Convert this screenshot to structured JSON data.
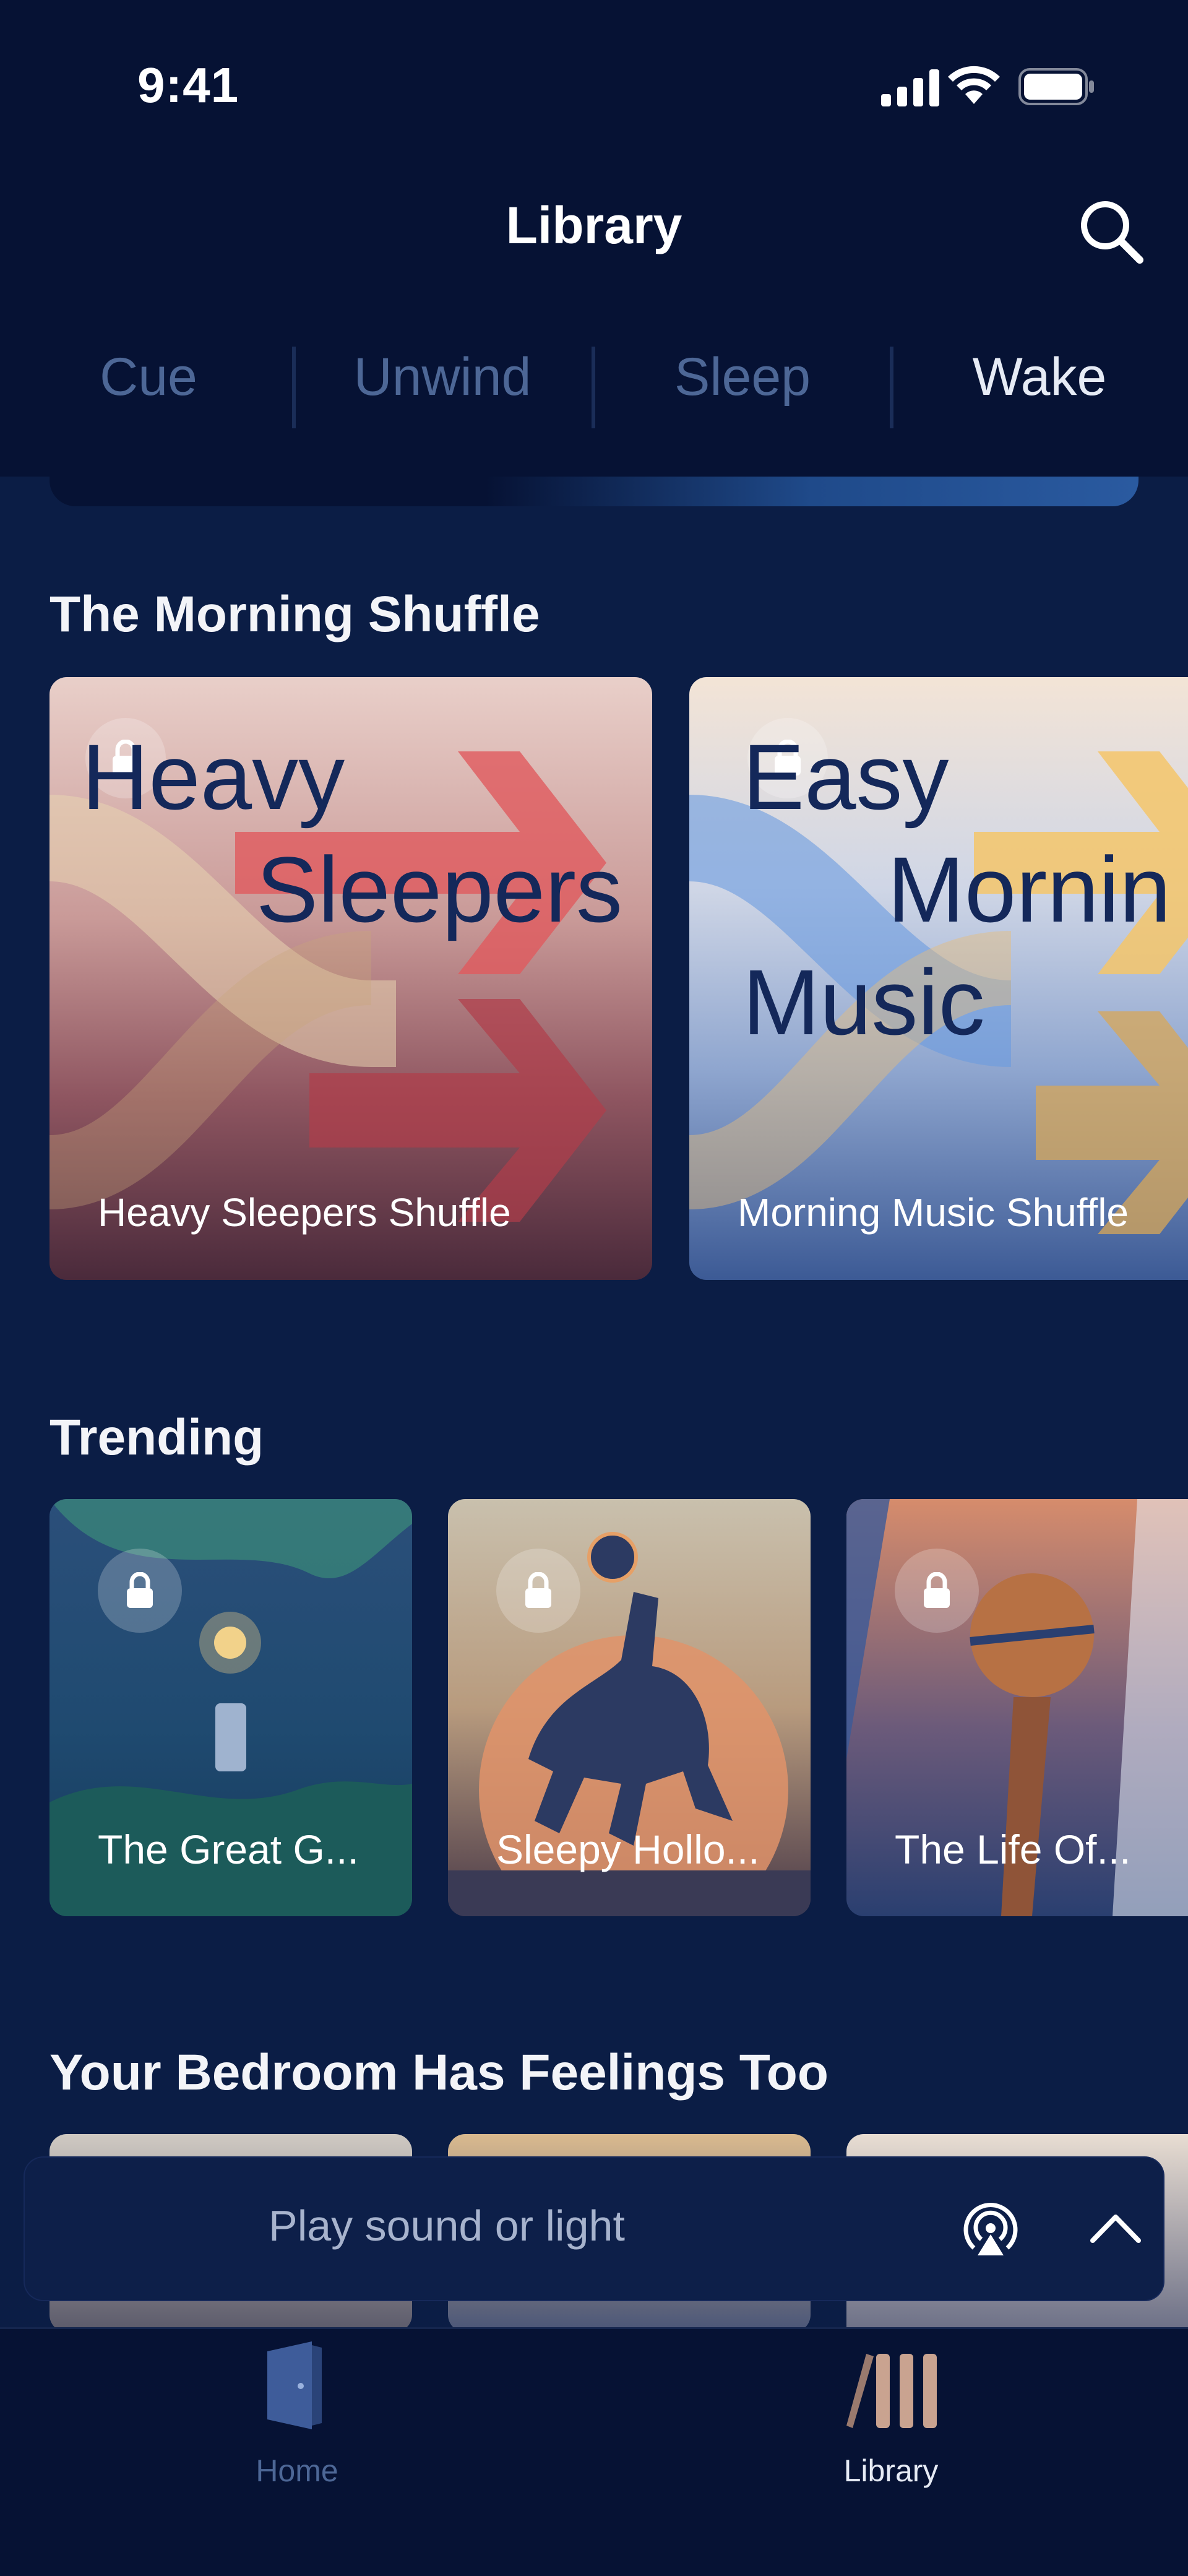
{
  "status_bar": {
    "time": "9:41"
  },
  "header": {
    "title": "Library"
  },
  "tabs": [
    {
      "label": "Cue",
      "active": false
    },
    {
      "label": "Unwind",
      "active": false
    },
    {
      "label": "Sleep",
      "active": false
    },
    {
      "label": "Wake",
      "active": true
    }
  ],
  "sections": {
    "morning_shuffle": {
      "title": "The Morning Shuffle",
      "cards": [
        {
          "art_line1": "Heavy",
          "art_line2": "Sleepers",
          "caption": "Heavy Sleepers Shuffle",
          "locked": true
        },
        {
          "art_line1": "Easy",
          "art_line2": "Mornin",
          "art_line3": "Music",
          "caption": "Morning Music Shuffle",
          "locked": true
        }
      ]
    },
    "trending": {
      "title": "Trending",
      "cards": [
        {
          "caption": "The Great G...",
          "locked": true
        },
        {
          "caption": "Sleepy Hollo...",
          "locked": true
        },
        {
          "caption": "The Life Of...",
          "locked": true
        }
      ]
    },
    "bedroom": {
      "title": "Your Bedroom Has Feelings Too"
    }
  },
  "mini_player": {
    "label": "Play sound or light"
  },
  "bottom_nav": [
    {
      "label": "Home",
      "active": false
    },
    {
      "label": "Library",
      "active": true
    }
  ],
  "colors": {
    "background": "#0b1d45",
    "header": "#061234",
    "tab_inactive": "#4d6796",
    "tab_active": "#e6ebf5"
  }
}
